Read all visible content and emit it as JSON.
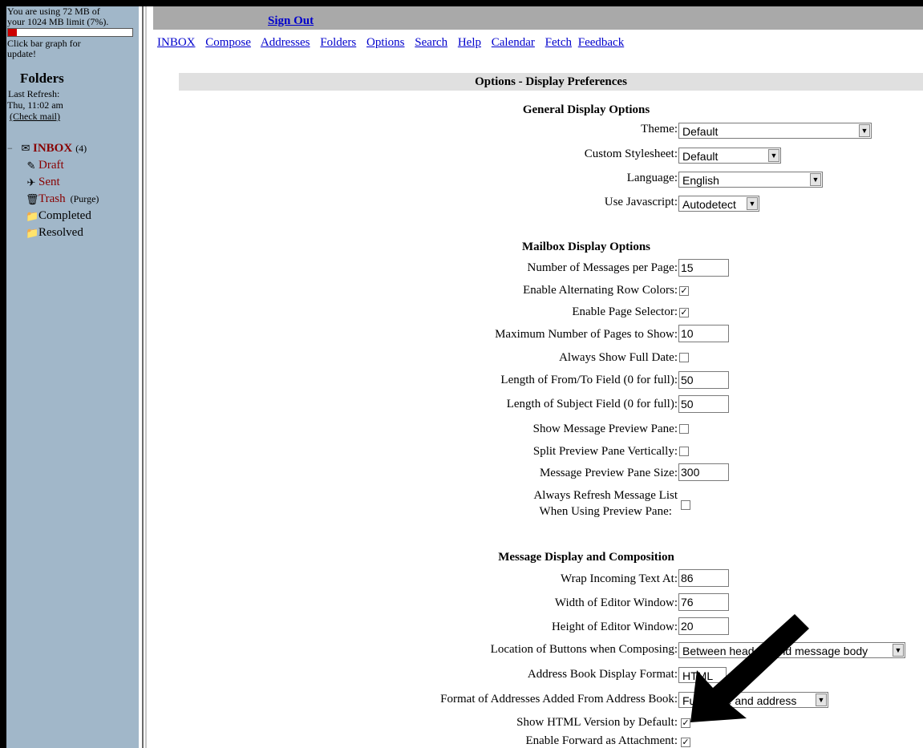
{
  "sidebar": {
    "quota_line1": "You are using 72 MB of",
    "quota_line2": "your 1024 MB limit (7%).",
    "quota_percent": 7,
    "quota_hint_line1": "Click bar graph for",
    "quota_hint_line2": "update!",
    "folders_title": "Folders",
    "last_refresh_label": "Last Refresh:",
    "last_refresh_time": "Thu, 11:02 am",
    "check_mail": "(Check mail)",
    "collapse_symbol": "−",
    "folders": [
      {
        "name": "INBOX",
        "count": "(4)",
        "icon": "inbox-icon",
        "glyph": "✉"
      },
      {
        "name": "Draft",
        "icon": "draft-icon",
        "glyph": "✎"
      },
      {
        "name": "Sent",
        "icon": "sent-icon",
        "glyph": "✈"
      },
      {
        "name": "Trash",
        "purge": "(Purge)",
        "icon": "trash-icon",
        "glyph": "🗑"
      },
      {
        "name": "Completed",
        "icon": "folder-icon",
        "glyph": "📁"
      },
      {
        "name": "Resolved",
        "icon": "folder-icon",
        "glyph": "📁"
      }
    ]
  },
  "header": {
    "sign_out": "Sign Out",
    "nav": [
      "INBOX",
      "Compose",
      "Addresses",
      "Folders",
      "Options",
      "Search",
      "Help",
      "Calendar",
      "Fetch",
      "Feedback"
    ]
  },
  "page_title": "Options - Display Preferences",
  "general": {
    "title": "General Display Options",
    "theme_label": "Theme:",
    "theme_value": "Default",
    "stylesheet_label": "Custom Stylesheet:",
    "stylesheet_value": "Default",
    "language_label": "Language:",
    "language_value": "English",
    "javascript_label": "Use Javascript:",
    "javascript_value": "Autodetect"
  },
  "mailbox": {
    "title": "Mailbox Display Options",
    "msgs_per_page_label": "Number of Messages per Page:",
    "msgs_per_page_value": "15",
    "alt_row_label": "Enable Alternating Row Colors:",
    "alt_row_checked": true,
    "page_selector_label": "Enable Page Selector:",
    "page_selector_checked": true,
    "max_pages_label": "Maximum Number of Pages to Show:",
    "max_pages_value": "10",
    "full_date_label": "Always Show Full Date:",
    "full_date_checked": false,
    "from_to_label": "Length of From/To Field (0 for full):",
    "from_to_value": "50",
    "subject_label": "Length of Subject Field (0 for full):",
    "subject_value": "50",
    "preview_pane_label": "Show Message Preview Pane:",
    "preview_pane_checked": false,
    "split_preview_label": "Split Preview Pane Vertically:",
    "split_preview_checked": false,
    "preview_size_label": "Message Preview Pane Size:",
    "preview_size_value": "300",
    "refresh_label_line1": "Always Refresh Message List",
    "refresh_label_line2": "When Using Preview Pane:",
    "refresh_checked": false
  },
  "message": {
    "title": "Message Display and Composition",
    "wrap_label": "Wrap Incoming Text At:",
    "wrap_value": "86",
    "editor_width_label": "Width of Editor Window:",
    "editor_width_value": "76",
    "editor_height_label": "Height of Editor Window:",
    "editor_height_value": "20",
    "buttons_location_label": "Location of Buttons when Composing:",
    "buttons_location_value": "Between headers and message body",
    "addr_format_label": "Address Book Display Format:",
    "addr_format_value": "HTML",
    "addr_added_label": "Format of Addresses Added From Address Book:",
    "addr_added_value": "Full name and address",
    "show_html_label": "Show HTML Version by Default:",
    "show_html_checked": true,
    "forward_attach_label": "Enable Forward as Attachment:",
    "forward_attach_checked": true
  }
}
